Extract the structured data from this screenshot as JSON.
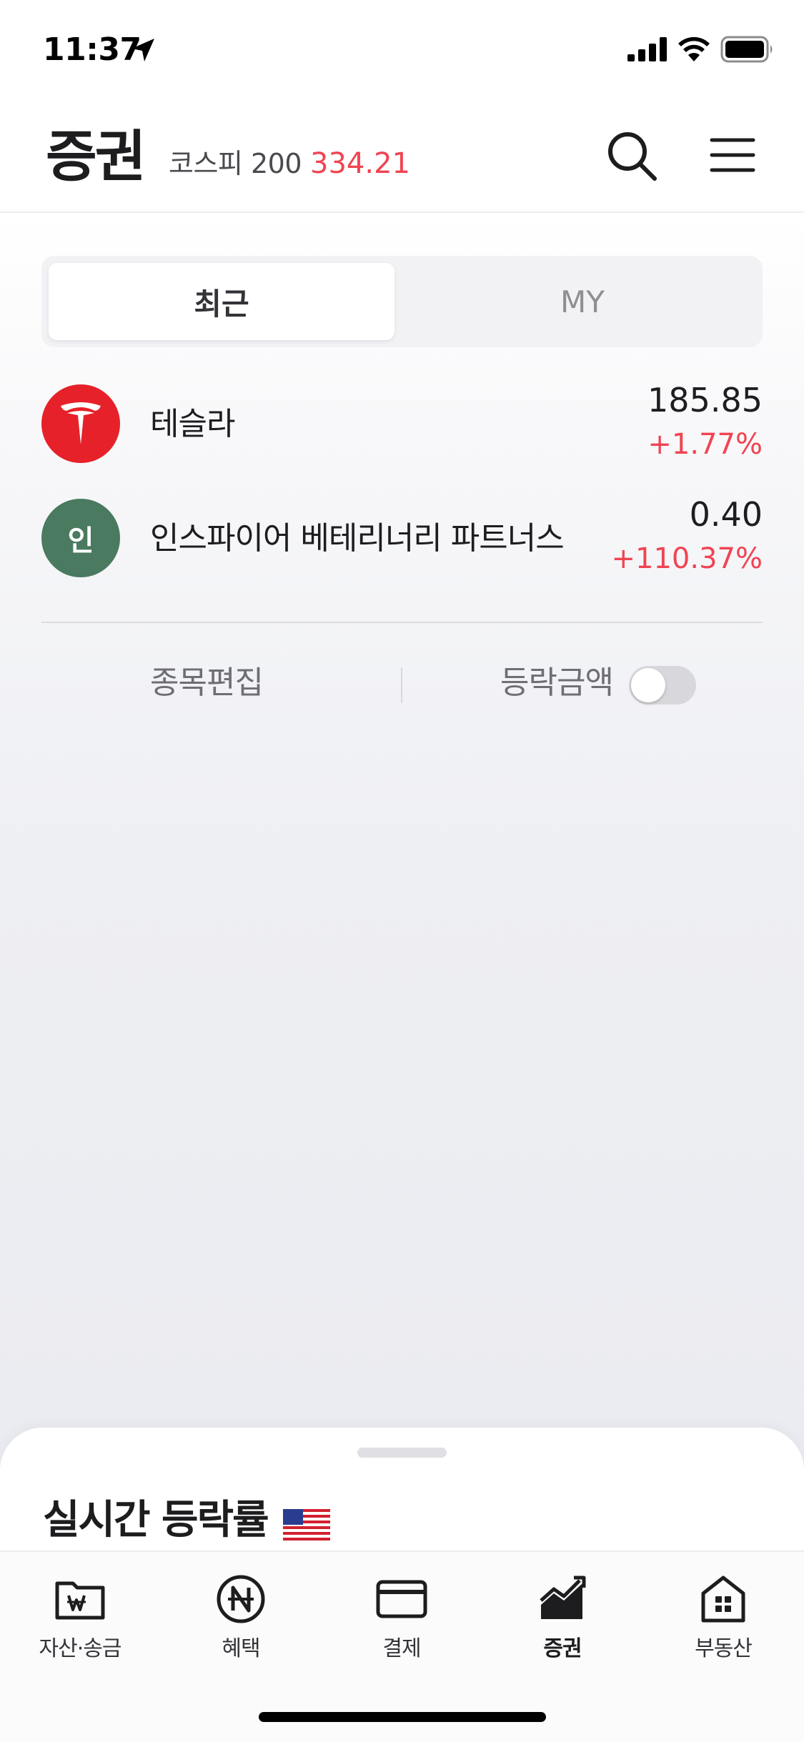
{
  "status_bar": {
    "time": "11:37"
  },
  "header": {
    "title": "증권",
    "index_name": "코스피 200",
    "index_value": "334.21"
  },
  "segments": {
    "recent": "최근",
    "my": "MY",
    "selected": "최근"
  },
  "stocks": [
    {
      "name": "테슬라",
      "price": "185.85",
      "change": "+1.77%",
      "logo": "tesla-logo"
    },
    {
      "name": "인스파이어 베테리너리 파트너스",
      "price": "0.40",
      "change": "+110.37%",
      "logo_text": "인"
    }
  ],
  "actions": {
    "edit": "종목편집",
    "change_amount": "등락금액",
    "change_amount_enabled": false
  },
  "sheet": {
    "title": "실시간 등락률"
  },
  "tabs": [
    {
      "label": "자산·송금",
      "icon": "wallet-folder-icon"
    },
    {
      "label": "혜택",
      "icon": "benefit-coin-icon"
    },
    {
      "label": "결제",
      "icon": "credit-card-icon"
    },
    {
      "label": "증권",
      "icon": "stock-chart-icon",
      "active": true
    },
    {
      "label": "부동산",
      "icon": "building-icon"
    }
  ],
  "colors": {
    "rise": "#f04452",
    "tesla_brand": "#e62129",
    "inspire_logo": "#4a7a5f"
  }
}
